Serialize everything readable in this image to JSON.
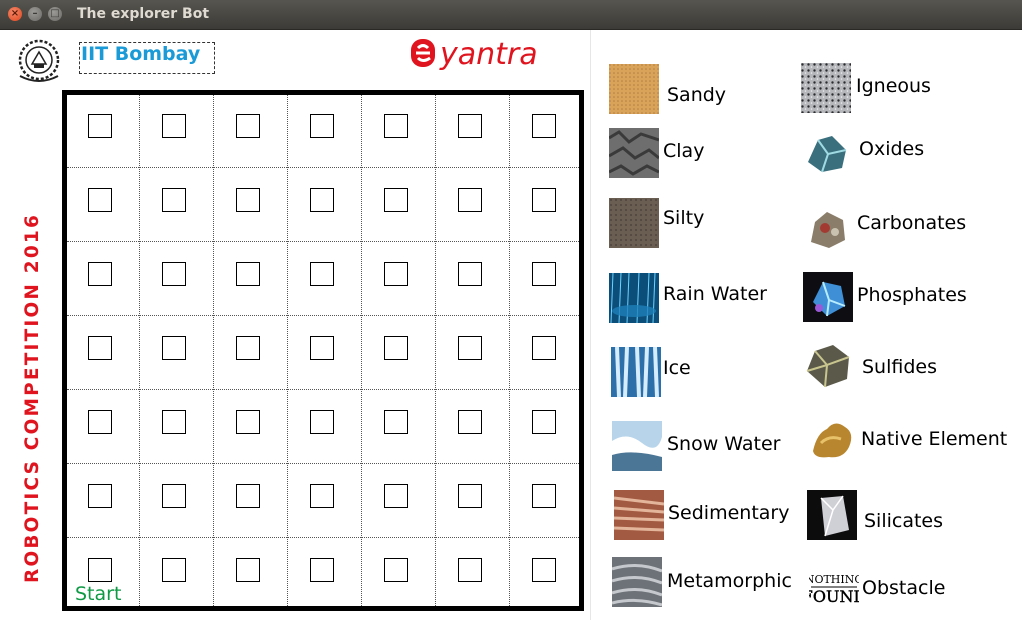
{
  "window": {
    "title": "The explorer Bot"
  },
  "header": {
    "iit_label": "IIT Bombay",
    "brand": "e-yantra"
  },
  "side_banner": "ROBOTICS COMPETITION 2016",
  "arena": {
    "rows": 7,
    "cols": 7,
    "start_label": "Start"
  },
  "legend": {
    "left_column": [
      {
        "label": "Sandy",
        "icon": "sandy-texture"
      },
      {
        "label": "Clay",
        "icon": "clay-texture"
      },
      {
        "label": "Silty",
        "icon": "silty-texture"
      },
      {
        "label": "Rain Water",
        "icon": "rain-water-photo"
      },
      {
        "label": "Ice",
        "icon": "ice-photo"
      },
      {
        "label": "Snow Water",
        "icon": "snow-water-photo"
      },
      {
        "label": "Sedimentary",
        "icon": "sedimentary-rock-photo"
      },
      {
        "label": "Metamorphic",
        "icon": "metamorphic-rock-photo"
      }
    ],
    "right_column": [
      {
        "label": "Igneous",
        "icon": "igneous-rock-photo"
      },
      {
        "label": "Oxides",
        "icon": "oxides-mineral-photo"
      },
      {
        "label": "Carbonates",
        "icon": "carbonates-mineral-photo"
      },
      {
        "label": "Phosphates",
        "icon": "phosphates-mineral-photo"
      },
      {
        "label": "Sulfides",
        "icon": "sulfides-mineral-photo"
      },
      {
        "label": "Native Element",
        "icon": "native-element-photo"
      },
      {
        "label": "Silicates",
        "icon": "silicates-mineral-photo"
      },
      {
        "label": "Obstacle",
        "icon": "nothing-found-sign"
      }
    ]
  },
  "colors": {
    "brand_red": "#e0141e",
    "iit_blue": "#1a9ad6",
    "start_green": "#0e9a44"
  }
}
